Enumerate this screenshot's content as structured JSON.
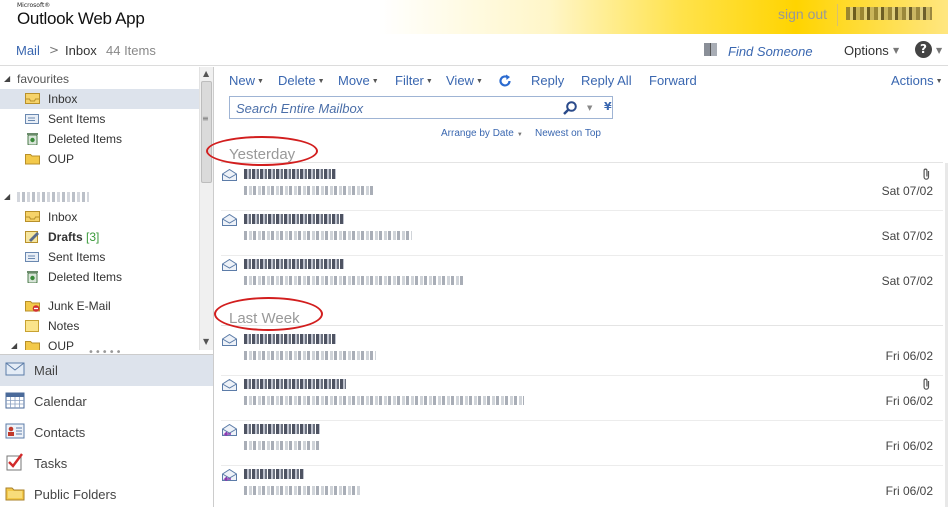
{
  "app": {
    "logo_small": "Microsoft®",
    "logo_name": "Outlook Web App",
    "sign_out": "sign out"
  },
  "breadcrumb": {
    "mail": "Mail",
    "separator": ">",
    "folder": "Inbox",
    "count": "44 Items",
    "find_someone": "Find Someone",
    "options": "Options",
    "help": "?"
  },
  "folders": {
    "favourites_label": "favourites",
    "favourites": [
      {
        "label": "Inbox",
        "icon": "inbox-icon",
        "selected": true
      },
      {
        "label": "Sent Items",
        "icon": "sent-items-icon"
      },
      {
        "label": "Deleted Items",
        "icon": "deleted-items-icon"
      },
      {
        "label": "OUP",
        "icon": "folder-icon"
      }
    ],
    "mailbox": [
      {
        "label": "Inbox",
        "icon": "inbox-icon"
      },
      {
        "label": "Drafts",
        "count": "[3]",
        "icon": "drafts-icon",
        "bold": true
      },
      {
        "label": "Sent Items",
        "icon": "sent-items-icon"
      },
      {
        "label": "Deleted Items",
        "icon": "deleted-items-icon"
      },
      {
        "label": "Junk E-Mail",
        "icon": "junk-mail-icon"
      },
      {
        "label": "Notes",
        "icon": "notes-icon"
      },
      {
        "label": "OUP",
        "icon": "folder-icon"
      }
    ]
  },
  "nav": [
    {
      "label": "Mail",
      "icon": "mail-icon",
      "selected": true
    },
    {
      "label": "Calendar",
      "icon": "calendar-icon"
    },
    {
      "label": "Contacts",
      "icon": "contacts-icon"
    },
    {
      "label": "Tasks",
      "icon": "tasks-icon"
    },
    {
      "label": "Public Folders",
      "icon": "public-folders-icon"
    }
  ],
  "toolbar": {
    "new": "New",
    "delete": "Delete",
    "move": "Move",
    "filter": "Filter",
    "view": "View",
    "reply": "Reply",
    "reply_all": "Reply All",
    "forward": "Forward",
    "actions": "Actions"
  },
  "search": {
    "placeholder": "Search Entire Mailbox"
  },
  "sort": {
    "arrange_by": "Arrange by Date",
    "order": "Newest on Top"
  },
  "groups": [
    {
      "label": "Yesterday",
      "messages": [
        {
          "date": "Sat 07/02",
          "attachment": true,
          "icon": "envelope-read-icon"
        },
        {
          "date": "Sat 07/02",
          "attachment": false,
          "icon": "envelope-read-icon"
        },
        {
          "date": "Sat 07/02",
          "attachment": false,
          "icon": "envelope-read-icon"
        }
      ]
    },
    {
      "label": "Last Week",
      "messages": [
        {
          "date": "Fri 06/02",
          "attachment": false,
          "icon": "envelope-read-icon"
        },
        {
          "date": "Fri 06/02",
          "attachment": true,
          "icon": "envelope-read-icon"
        },
        {
          "date": "Fri 06/02",
          "attachment": false,
          "icon": "envelope-replied-icon"
        },
        {
          "date": "Fri 06/02",
          "attachment": false,
          "icon": "envelope-replied-icon"
        }
      ]
    }
  ],
  "colors": {
    "accent": "#3a67b0",
    "highlight_circle": "#d21e1e",
    "selection": "#dde3ec"
  }
}
